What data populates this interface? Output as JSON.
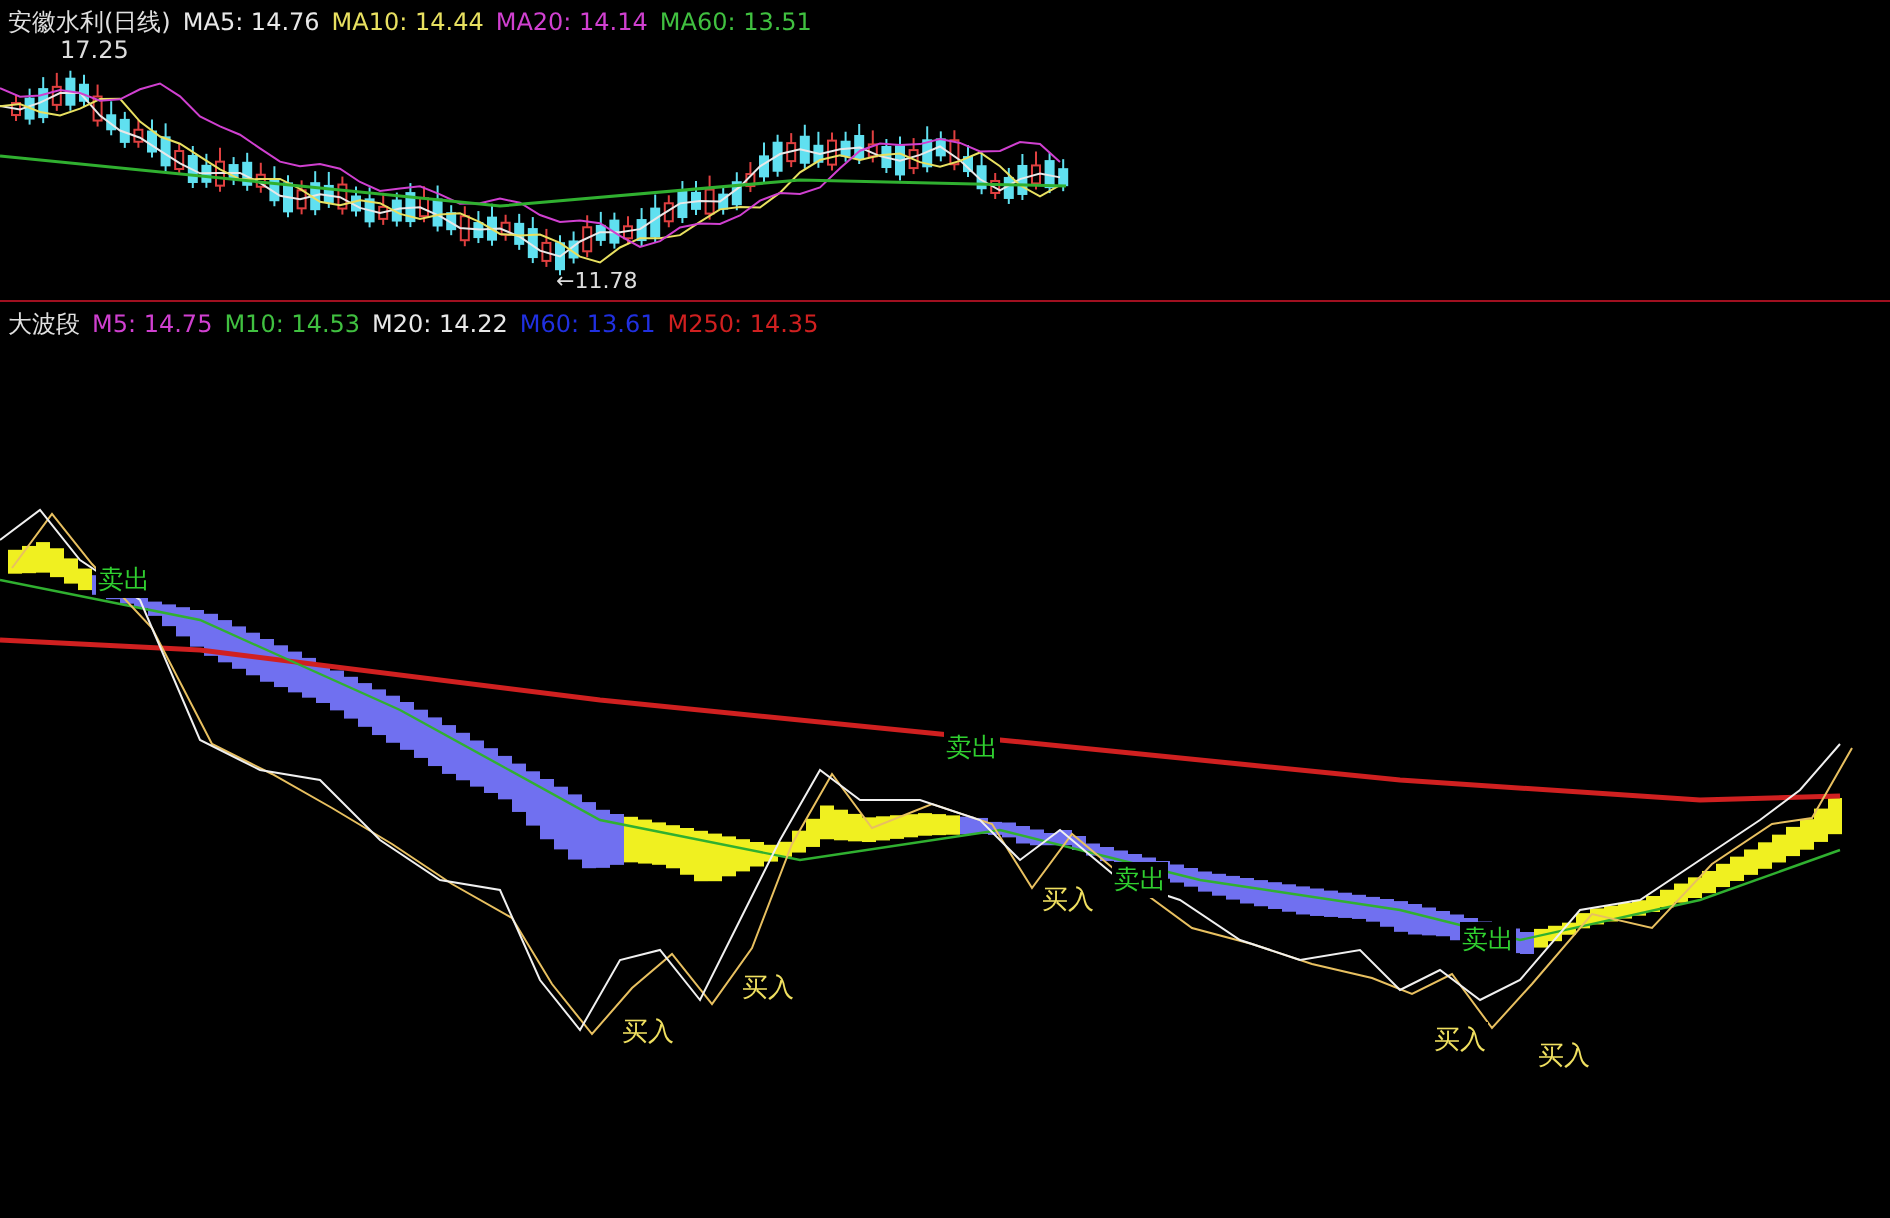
{
  "price_panel": {
    "title": "安徽水利(日线)",
    "indicators": [
      {
        "label": "MA5: 14.76",
        "color": "#e8e8e8"
      },
      {
        "label": "MA10: 14.44",
        "color": "#e8e060"
      },
      {
        "label": "MA20: 14.14",
        "color": "#d040d0"
      },
      {
        "label": "MA60: 13.51",
        "color": "#40c040"
      }
    ],
    "high_label": "17.25",
    "low_label": "←11.78"
  },
  "wave_panel": {
    "title": "大波段",
    "indicators": [
      {
        "label": "M5: 14.75",
        "color": "#d040d0"
      },
      {
        "label": "M10: 14.53",
        "color": "#40c040"
      },
      {
        "label": "M20: 14.22",
        "color": "#e8e8e8"
      },
      {
        "label": "M60: 13.61",
        "color": "#2030e0"
      },
      {
        "label": "M250: 14.35",
        "color": "#d02020"
      }
    ],
    "signals": [
      {
        "kind": "sell",
        "text": "卖出"
      },
      {
        "kind": "sell",
        "text": "卖出"
      },
      {
        "kind": "sell",
        "text": "卖出"
      },
      {
        "kind": "sell",
        "text": "卖出"
      },
      {
        "kind": "buy",
        "text": "买入"
      },
      {
        "kind": "buy",
        "text": "买入"
      },
      {
        "kind": "buy",
        "text": "买入"
      },
      {
        "kind": "buy",
        "text": "买入"
      },
      {
        "kind": "buy",
        "text": "买入"
      }
    ]
  }
}
